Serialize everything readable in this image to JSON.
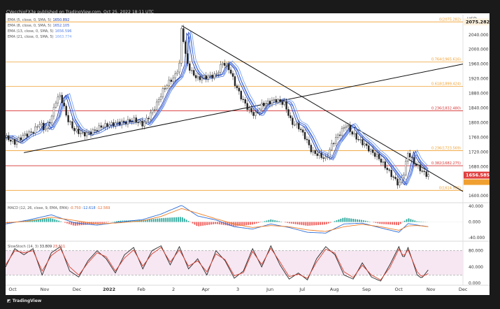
{
  "header": {
    "publisher": "CVecchioFX3e published on TradingView.com, Oct 25, 2022 18:11 UTC"
  },
  "footer": {
    "brand": "TradingView"
  },
  "legend": [
    {
      "label": "EMA (5, close, 0, SMA, 5)",
      "value": "1650.892",
      "color": "#1e3ca8"
    },
    {
      "label": "EMA (8, close, 0, SMA, 5)",
      "value": "1652.105",
      "color": "#3558d0"
    },
    {
      "label": "EMA (13, close, 0, SMA, 5)",
      "value": "1656.596",
      "color": "#4f7be6"
    },
    {
      "label": "EMA (21, close, 0, SMA, 5)",
      "value": "1663.774",
      "color": "#7aa3f0"
    }
  ],
  "macd": {
    "label": "MACD (12, 26, close, 9, EMA, EMA)",
    "values": [
      "-0.750",
      "-12.618",
      "-12.569"
    ]
  },
  "stoch": {
    "label": "SlowStoch (14, 3)",
    "values": [
      "33.809",
      "23.811"
    ]
  },
  "chart_data": {
    "type": "line",
    "currency": "USD",
    "x_ticks": [
      "Oct",
      "Nov",
      "Dec",
      "2022",
      "Feb",
      "2",
      "Apr",
      "3",
      "Jun",
      "Jul",
      "Aug",
      "Sep",
      "Oct",
      "Nov",
      "Dec"
    ],
    "y_ticks": [
      "2040.000",
      "2000.000",
      "1960.000",
      "1920.000",
      "1880.000",
      "1840.000",
      "1800.000",
      "1760.000",
      "1720.000",
      "1680.000",
      "1640.000",
      "1600.000"
    ],
    "ylim": [
      1585,
      2095
    ],
    "last_price": "1656.585",
    "high_label": "2075.282",
    "fib_levels": [
      {
        "label": "0(2075.282)",
        "price": 2075.282,
        "color": "#f0a030"
      },
      {
        "label": "0.764(1965.616)",
        "price": 1965.616,
        "color": "#f0a030"
      },
      {
        "label": "0.618(1899.424)",
        "price": 1899.424,
        "color": "#f0a030"
      },
      {
        "label": "0.236(1832.480)",
        "price": 1832.48,
        "color": "#d83030"
      },
      {
        "label": "0.236(1723.569)",
        "price": 1723.569,
        "color": "#f0a030"
      },
      {
        "label": "0.382(1682.275)",
        "price": 1682.275,
        "color": "#d83030"
      },
      {
        "label": "0(1614.925)",
        "price": 1614.925,
        "color": "#f0a030"
      }
    ],
    "trendlines": [
      {
        "from": [
          0.04,
          1718
        ],
        "to": [
          1.0,
          1960
        ]
      },
      {
        "from": [
          0.385,
          2065
        ],
        "to": [
          1.0,
          1612
        ]
      }
    ],
    "price_series": [
      [
        0.0,
        1760
      ],
      [
        0.02,
        1745
      ],
      [
        0.04,
        1765
      ],
      [
        0.06,
        1775
      ],
      [
        0.075,
        1800
      ],
      [
        0.085,
        1780
      ],
      [
        0.1,
        1812
      ],
      [
        0.11,
        1860
      ],
      [
        0.12,
        1875
      ],
      [
        0.135,
        1810
      ],
      [
        0.15,
        1780
      ],
      [
        0.17,
        1768
      ],
      [
        0.19,
        1775
      ],
      [
        0.21,
        1790
      ],
      [
        0.23,
        1795
      ],
      [
        0.25,
        1800
      ],
      [
        0.265,
        1802
      ],
      [
        0.28,
        1808
      ],
      [
        0.3,
        1795
      ],
      [
        0.315,
        1820
      ],
      [
        0.33,
        1850
      ],
      [
        0.345,
        1890
      ],
      [
        0.36,
        1915
      ],
      [
        0.37,
        1925
      ],
      [
        0.38,
        1960
      ],
      [
        0.385,
        2065
      ],
      [
        0.395,
        1970
      ],
      [
        0.405,
        1940
      ],
      [
        0.42,
        1920
      ],
      [
        0.44,
        1925
      ],
      [
        0.46,
        1930
      ],
      [
        0.475,
        1965
      ],
      [
        0.49,
        1945
      ],
      [
        0.5,
        1910
      ],
      [
        0.515,
        1870
      ],
      [
        0.53,
        1838
      ],
      [
        0.545,
        1820
      ],
      [
        0.56,
        1848
      ],
      [
        0.575,
        1855
      ],
      [
        0.59,
        1862
      ],
      [
        0.61,
        1852
      ],
      [
        0.625,
        1800
      ],
      [
        0.64,
        1790
      ],
      [
        0.655,
        1760
      ],
      [
        0.67,
        1720
      ],
      [
        0.685,
        1712
      ],
      [
        0.7,
        1700
      ],
      [
        0.715,
        1745
      ],
      [
        0.73,
        1770
      ],
      [
        0.745,
        1795
      ],
      [
        0.755,
        1775
      ],
      [
        0.77,
        1755
      ],
      [
        0.785,
        1740
      ],
      [
        0.8,
        1720
      ],
      [
        0.815,
        1705
      ],
      [
        0.83,
        1680
      ],
      [
        0.845,
        1655
      ],
      [
        0.86,
        1630
      ],
      [
        0.87,
        1660
      ],
      [
        0.88,
        1720
      ],
      [
        0.89,
        1695
      ],
      [
        0.905,
        1675
      ],
      [
        0.915,
        1662
      ],
      [
        0.925,
        1655
      ]
    ],
    "ema_series": [
      {
        "name": "EMA 5",
        "color": "#1e3ca8",
        "offset": 0
      },
      {
        "name": "EMA 8",
        "color": "#3558d0",
        "offset": 8
      },
      {
        "name": "EMA 13",
        "color": "#4f7be6",
        "offset": -10
      },
      {
        "name": "EMA 21",
        "color": "#7aa3f0",
        "offset": 16
      }
    ],
    "macd_axis": [
      "40.000",
      "0.000",
      "-40.000"
    ],
    "macd_ylim": [
      -45,
      45
    ],
    "macd_series": {
      "macd": [
        [
          0.0,
          -5
        ],
        [
          0.05,
          5
        ],
        [
          0.1,
          18
        ],
        [
          0.15,
          -2
        ],
        [
          0.2,
          -8
        ],
        [
          0.25,
          0
        ],
        [
          0.3,
          6
        ],
        [
          0.34,
          20
        ],
        [
          0.385,
          42
        ],
        [
          0.42,
          15
        ],
        [
          0.46,
          5
        ],
        [
          0.5,
          -12
        ],
        [
          0.54,
          -18
        ],
        [
          0.58,
          -5
        ],
        [
          0.62,
          -14
        ],
        [
          0.66,
          -26
        ],
        [
          0.7,
          -28
        ],
        [
          0.74,
          -5
        ],
        [
          0.78,
          -3
        ],
        [
          0.82,
          -15
        ],
        [
          0.86,
          -26
        ],
        [
          0.88,
          -4
        ],
        [
          0.9,
          -8
        ],
        [
          0.925,
          -12
        ]
      ],
      "signal": [
        [
          0.0,
          -2
        ],
        [
          0.05,
          2
        ],
        [
          0.1,
          12
        ],
        [
          0.15,
          4
        ],
        [
          0.2,
          -5
        ],
        [
          0.25,
          -2
        ],
        [
          0.3,
          3
        ],
        [
          0.34,
          14
        ],
        [
          0.385,
          34
        ],
        [
          0.42,
          22
        ],
        [
          0.46,
          8
        ],
        [
          0.5,
          -5
        ],
        [
          0.54,
          -14
        ],
        [
          0.58,
          -9
        ],
        [
          0.62,
          -12
        ],
        [
          0.66,
          -20
        ],
        [
          0.7,
          -24
        ],
        [
          0.74,
          -12
        ],
        [
          0.78,
          -6
        ],
        [
          0.82,
          -12
        ],
        [
          0.86,
          -21
        ],
        [
          0.88,
          -10
        ],
        [
          0.9,
          -9
        ],
        [
          0.925,
          -12
        ]
      ]
    },
    "stoch_axis": [
      "80.000",
      "40.000",
      "0.000"
    ],
    "stoch_ylim": [
      0,
      100
    ],
    "stoch_bands": [
      80,
      20
    ],
    "stoch_series": {
      "k": [
        [
          0.0,
          40
        ],
        [
          0.02,
          85
        ],
        [
          0.04,
          70
        ],
        [
          0.06,
          85
        ],
        [
          0.08,
          20
        ],
        [
          0.1,
          75
        ],
        [
          0.12,
          90
        ],
        [
          0.14,
          30
        ],
        [
          0.16,
          15
        ],
        [
          0.18,
          55
        ],
        [
          0.2,
          80
        ],
        [
          0.22,
          60
        ],
        [
          0.24,
          25
        ],
        [
          0.26,
          70
        ],
        [
          0.28,
          88
        ],
        [
          0.3,
          35
        ],
        [
          0.32,
          80
        ],
        [
          0.34,
          92
        ],
        [
          0.36,
          45
        ],
        [
          0.38,
          90
        ],
        [
          0.4,
          35
        ],
        [
          0.42,
          60
        ],
        [
          0.44,
          20
        ],
        [
          0.46,
          80
        ],
        [
          0.48,
          55
        ],
        [
          0.5,
          12
        ],
        [
          0.52,
          30
        ],
        [
          0.54,
          85
        ],
        [
          0.56,
          40
        ],
        [
          0.58,
          92
        ],
        [
          0.6,
          45
        ],
        [
          0.62,
          10
        ],
        [
          0.64,
          25
        ],
        [
          0.66,
          8
        ],
        [
          0.68,
          60
        ],
        [
          0.7,
          90
        ],
        [
          0.72,
          70
        ],
        [
          0.74,
          20
        ],
        [
          0.76,
          10
        ],
        [
          0.78,
          50
        ],
        [
          0.8,
          15
        ],
        [
          0.82,
          5
        ],
        [
          0.84,
          45
        ],
        [
          0.86,
          90
        ],
        [
          0.87,
          60
        ],
        [
          0.88,
          88
        ],
        [
          0.9,
          20
        ],
        [
          0.91,
          12
        ],
        [
          0.925,
          34
        ]
      ],
      "d": [
        [
          0.0,
          45
        ],
        [
          0.02,
          80
        ],
        [
          0.04,
          75
        ],
        [
          0.06,
          80
        ],
        [
          0.08,
          30
        ],
        [
          0.1,
          68
        ],
        [
          0.12,
          85
        ],
        [
          0.14,
          40
        ],
        [
          0.16,
          20
        ],
        [
          0.18,
          50
        ],
        [
          0.2,
          75
        ],
        [
          0.22,
          65
        ],
        [
          0.24,
          30
        ],
        [
          0.26,
          62
        ],
        [
          0.28,
          82
        ],
        [
          0.3,
          42
        ],
        [
          0.32,
          72
        ],
        [
          0.34,
          88
        ],
        [
          0.36,
          52
        ],
        [
          0.38,
          82
        ],
        [
          0.4,
          42
        ],
        [
          0.42,
          55
        ],
        [
          0.44,
          28
        ],
        [
          0.46,
          72
        ],
        [
          0.48,
          58
        ],
        [
          0.5,
          18
        ],
        [
          0.52,
          26
        ],
        [
          0.54,
          78
        ],
        [
          0.56,
          46
        ],
        [
          0.58,
          86
        ],
        [
          0.6,
          52
        ],
        [
          0.62,
          16
        ],
        [
          0.64,
          22
        ],
        [
          0.66,
          12
        ],
        [
          0.68,
          52
        ],
        [
          0.7,
          84
        ],
        [
          0.72,
          74
        ],
        [
          0.74,
          28
        ],
        [
          0.76,
          14
        ],
        [
          0.78,
          44
        ],
        [
          0.8,
          20
        ],
        [
          0.82,
          8
        ],
        [
          0.84,
          38
        ],
        [
          0.86,
          84
        ],
        [
          0.87,
          66
        ],
        [
          0.88,
          82
        ],
        [
          0.9,
          28
        ],
        [
          0.91,
          16
        ],
        [
          0.925,
          24
        ]
      ]
    }
  }
}
